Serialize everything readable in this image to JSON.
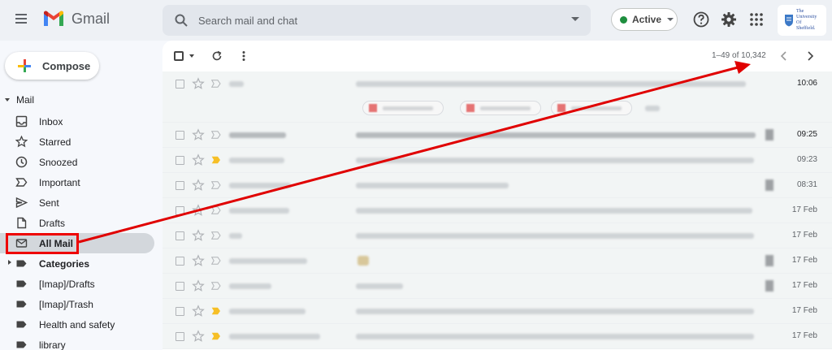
{
  "app": {
    "name": "Gmail"
  },
  "search": {
    "placeholder": "Search mail and chat"
  },
  "status": {
    "label": "Active",
    "color": "#1e8e3e"
  },
  "university_logo": {
    "lines": [
      "The",
      "University",
      "Of",
      "Sheffield."
    ]
  },
  "compose": {
    "label": "Compose"
  },
  "mail_section": {
    "label": "Mail"
  },
  "nav": [
    {
      "label": "Inbox",
      "icon": "inbox-icon"
    },
    {
      "label": "Starred",
      "icon": "star-icon"
    },
    {
      "label": "Snoozed",
      "icon": "clock-icon"
    },
    {
      "label": "Important",
      "icon": "important-icon"
    },
    {
      "label": "Sent",
      "icon": "send-icon"
    },
    {
      "label": "Drafts",
      "icon": "draft-icon"
    },
    {
      "label": "All Mail",
      "icon": "mail-icon",
      "active": true
    },
    {
      "label": "Categories",
      "icon": "label-icon"
    },
    {
      "label": "[Imap]/Drafts",
      "icon": "label-icon"
    },
    {
      "label": "[Imap]/Trash",
      "icon": "label-icon"
    },
    {
      "label": "Health and safety",
      "icon": "label-icon"
    },
    {
      "label": "library",
      "icon": "label-icon"
    }
  ],
  "pager": {
    "text": "1–49 of 10,342"
  },
  "emails": [
    {
      "date": "10:06",
      "important": false,
      "attachments": 3
    },
    {
      "date": "09:25",
      "important": false
    },
    {
      "date": "09:23",
      "important": true
    },
    {
      "date": "08:31",
      "important": false
    },
    {
      "date": "17 Feb",
      "important": false
    },
    {
      "date": "17 Feb",
      "important": false
    },
    {
      "date": "17 Feb",
      "important": false
    },
    {
      "date": "17 Feb",
      "important": false
    },
    {
      "date": "17 Feb",
      "important": true
    },
    {
      "date": "17 Feb",
      "important": true
    }
  ],
  "annotation": {
    "color": "#e00000"
  }
}
